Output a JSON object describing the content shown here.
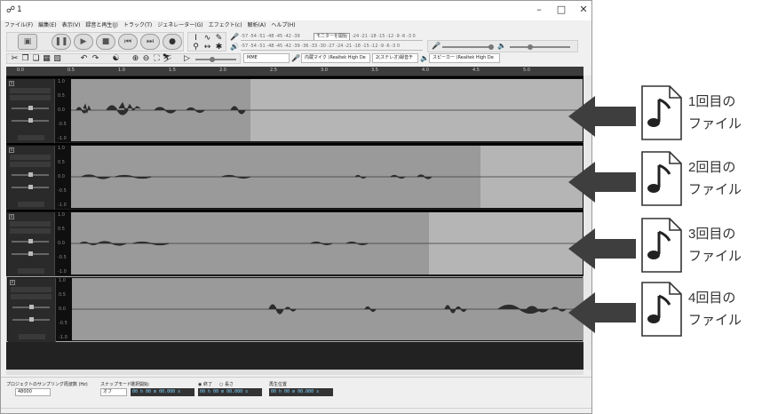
{
  "window": {
    "title": "1",
    "min": "–",
    "max": "□",
    "close": "✕"
  },
  "menu": [
    "ファイル(F)",
    "編集(E)",
    "表示(V)",
    "録音と再生(J)",
    "トラック(T)",
    "ジェネレーター(G)",
    "エフェクト(c)",
    "解析(A)",
    "ヘルプ(H)"
  ],
  "toolbar": {
    "record_meter_scale": "-57 -54 -51 -48 -45 -42 -39",
    "record_meter_rest": "-24 -21 -18 -15 -12 -9 -6 -3 0",
    "monitor_label": "モニターを開始",
    "play_meter_scale": "-57 -54 -51 -48 -45 -42 -39 -36 -33 -30 -27 -24 -21 -18 -15 -12 -9 -6 -3 0",
    "host": "MME",
    "record_device": "内蔵マイク (Realtek High De",
    "channels": "2(ステレオ)録音チ",
    "playback_device": "スピーカー (Realtek High De"
  },
  "ruler": [
    "0.0",
    "0.5",
    "1.0",
    "1.5",
    "2.0",
    "2.5",
    "3.0",
    "3.5",
    "4.0",
    "4.5",
    "5.0"
  ],
  "vscale": [
    "1.0",
    "0.5",
    "0.0",
    "-0.5",
    "-1.0"
  ],
  "bottom": {
    "rate_label": "プロジェクトのサンプリング周波数 (Hz)",
    "rate_value": "48000",
    "snap_label": "スナップモード",
    "snap_value": "オフ",
    "selection_label": "選択開始:",
    "end_label": "終了",
    "length_label": "長さ",
    "position_label": "再生位置",
    "start_time": "00 h 00 m 00.000 s",
    "end_time": "00 h 00 m 00.000 s",
    "position_time": "00 h 00 m 00.000 s"
  },
  "annotations": [
    {
      "line1": "1回目の",
      "line2": "ファイル"
    },
    {
      "line1": "2回目の",
      "line2": "ファイル"
    },
    {
      "line1": "3回目の",
      "line2": "ファイル"
    },
    {
      "line1": "4回目の",
      "line2": "ファイル"
    }
  ],
  "colors": {
    "clip": "#9a9a9a",
    "track_bg": "#b5b5b5",
    "waveform": "#3a3a3a",
    "arrow": "#3e3e3e"
  },
  "tracks": [
    {
      "clip_end_fraction": 0.35,
      "selected": false
    },
    {
      "clip_end_fraction": 0.8,
      "selected": false
    },
    {
      "clip_end_fraction": 0.7,
      "selected": false
    },
    {
      "clip_end_fraction": 1.0,
      "selected": true
    }
  ]
}
